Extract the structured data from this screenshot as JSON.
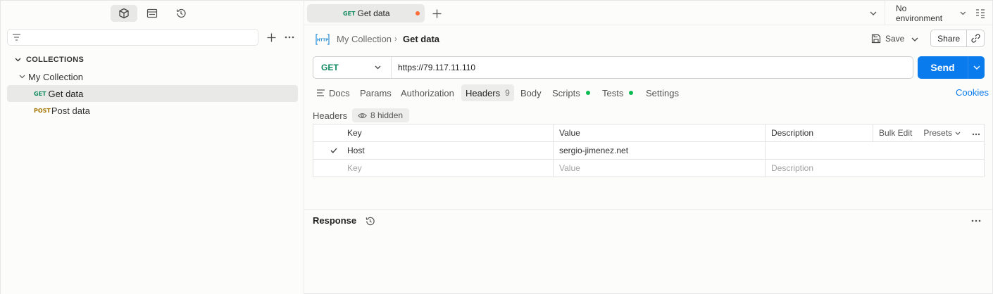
{
  "sidebar": {
    "top_icons": [
      "collections-icon",
      "environments-icon",
      "history-icon"
    ],
    "filter_placeholder": "",
    "section_title": "COLLECTIONS",
    "collection_name": "My Collection",
    "requests": [
      {
        "method": "GET",
        "name": "Get data"
      },
      {
        "method": "POST",
        "name": "Post data"
      }
    ]
  },
  "tab": {
    "method": "GET",
    "title": "Get data"
  },
  "environment": {
    "selected": "No environment"
  },
  "breadcrumb": {
    "collection": "My Collection",
    "separator": "›",
    "request": "Get data"
  },
  "actions": {
    "save": "Save",
    "share": "Share",
    "send": "Send"
  },
  "request": {
    "method": "GET",
    "url": "https://79.117.11.110"
  },
  "request_tabs": {
    "docs": "Docs",
    "params": "Params",
    "authorization": "Authorization",
    "headers": "Headers",
    "headers_count": "9",
    "body": "Body",
    "scripts": "Scripts",
    "tests": "Tests",
    "settings": "Settings",
    "cookies": "Cookies"
  },
  "headers": {
    "label": "Headers",
    "hidden": "8 hidden",
    "columns": {
      "key": "Key",
      "value": "Value",
      "description": "Description"
    },
    "bulk_edit": "Bulk Edit",
    "presets": "Presets",
    "rows": [
      {
        "key": "Host",
        "value": "sergio-jimenez.net",
        "description": ""
      }
    ],
    "placeholders": {
      "key": "Key",
      "value": "Value",
      "description": "Description"
    }
  },
  "response": {
    "title": "Response"
  },
  "colors": {
    "get": "#0f8a5f",
    "post": "#a67700",
    "send": "#097bed",
    "unsaved": "#ff6c37",
    "active_dot": "#0cbb52"
  }
}
